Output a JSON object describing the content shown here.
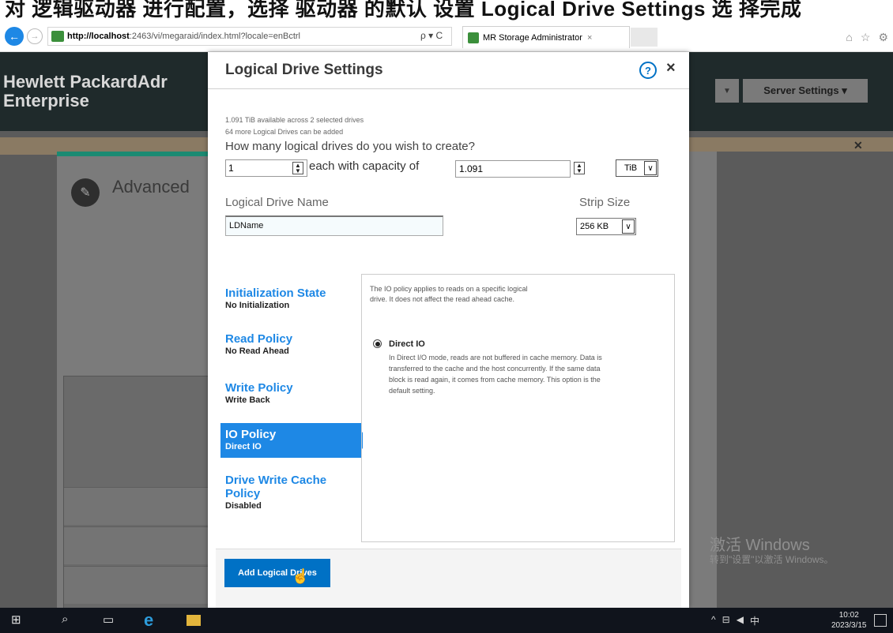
{
  "top_strip": {
    "text": "对 逻辑驱动器 进行配置，选择 驱动器 的默认 设置 Logical Drive Settings 选 择完成"
  },
  "browser": {
    "url_host": "http://localhost",
    "url_rest": ":2463/vi/megaraid/index.html?locale=enBctrl",
    "url_controls": "ρ ▾ C",
    "tab_title": "MR Storage Administrator",
    "tab_close": "×"
  },
  "app": {
    "brand": "Hewlett PackardAdr\nEnterprise",
    "server_settings": "Server Settings ▾",
    "page_heading": "Advanced",
    "windows_watermark": "激活 Windows",
    "windows_watermark_sub": "转到\"设置\"以激活 Windows。"
  },
  "modal": {
    "title": "Logical Drive Settings",
    "help": "?",
    "close": "×",
    "available_text": "1.091 TiB available across 2 selected drives",
    "more_text": "64 more Logical Drives can be added",
    "question": "How many logical drives do you wish to create?",
    "quantity": "1",
    "each_with_capacity": "each with capacity of",
    "capacity": "1.091",
    "unit": "TiB",
    "ld_name_label": "Logical Drive Name",
    "ld_name_value": "LDName",
    "strip_size_label": "Strip Size",
    "strip_size_value": "256 KB",
    "menu": [
      {
        "label": "Initialization State",
        "value": "No Initialization",
        "active": false
      },
      {
        "label": "Read Policy",
        "value": "No Read Ahead",
        "active": false
      },
      {
        "label": "Write Policy",
        "value": "Write Back",
        "active": false
      },
      {
        "label": "IO Policy",
        "value": "Direct IO",
        "active": true
      },
      {
        "label": "Drive Write Cache Policy",
        "value": "Disabled",
        "active": false
      }
    ],
    "detail": {
      "description": "The IO policy applies to reads on a specific logical drive. It does not affect the read ahead cache.",
      "option_title": "Direct IO",
      "option_desc": "In Direct I/O mode, reads are not buffered in cache memory. Data is transferred to the cache and the host concurrently. If the same data block is read again, it comes from cache memory. This option is the default setting."
    },
    "add_button": "Add Logical Drives"
  },
  "taskbar": {
    "time": "10:02",
    "date": "2023/3/15",
    "ime": "中"
  },
  "colors": {
    "accent_blue": "#1e88e5",
    "button_blue": "#0071c5",
    "header_dark": "#1f2a2b",
    "overlay_gray": "#5b5b5b"
  }
}
